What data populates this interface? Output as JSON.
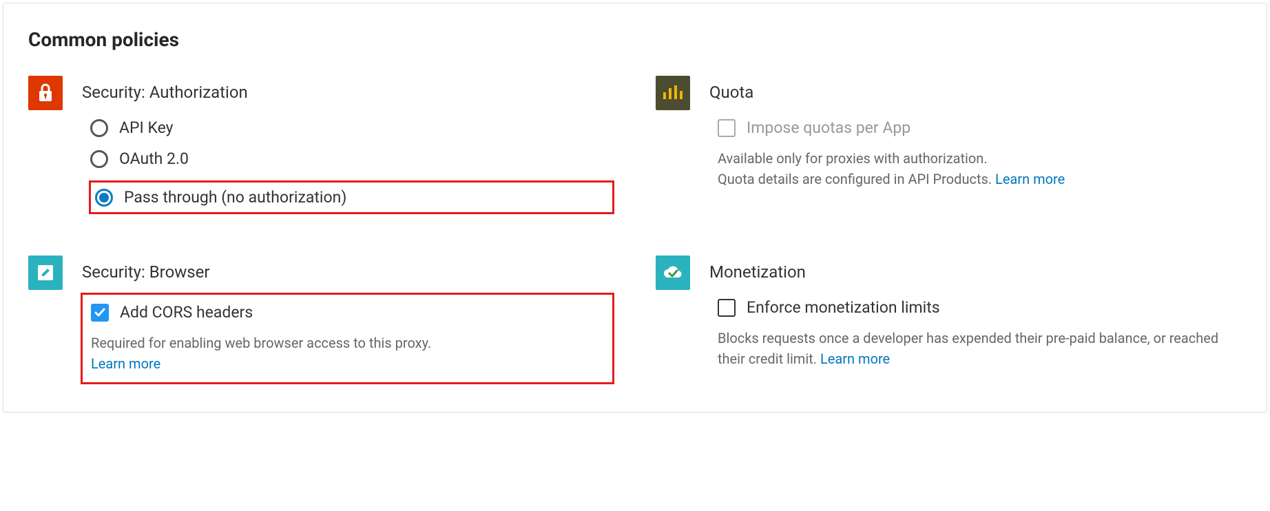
{
  "page": {
    "title": "Common policies"
  },
  "security_auth": {
    "title": "Security: Authorization",
    "options": {
      "api_key": "API Key",
      "oauth": "OAuth 2.0",
      "pass_through": "Pass through (no authorization)"
    }
  },
  "quota": {
    "title": "Quota",
    "option": "Impose quotas per App",
    "helper_line1": "Available only for proxies with authorization.",
    "helper_line2": "Quota details are configured in API Products. ",
    "learn_more": "Learn more"
  },
  "security_browser": {
    "title": "Security: Browser",
    "option": "Add CORS headers",
    "helper": "Required for enabling web browser access to this proxy.",
    "learn_more": "Learn more"
  },
  "monetization": {
    "title": "Monetization",
    "option": "Enforce monetization limits",
    "helper": "Blocks requests once a developer has expended their pre-paid balance, or reached their credit limit. ",
    "learn_more": "Learn more"
  }
}
